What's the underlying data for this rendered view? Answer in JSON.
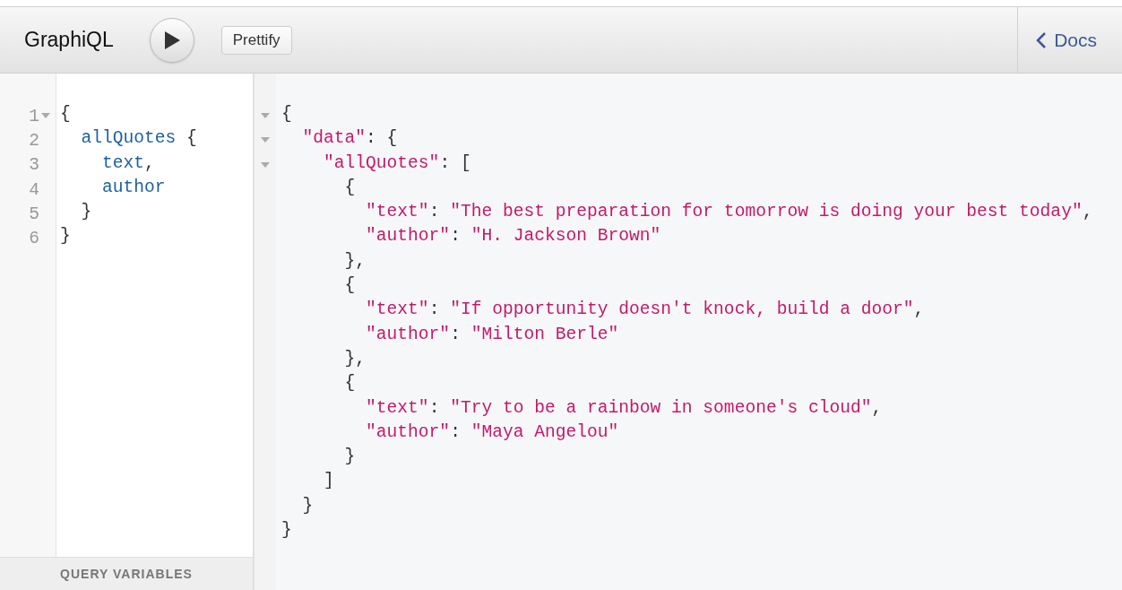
{
  "toolbar": {
    "title": "GraphiQL",
    "prettify_button": "Prettify",
    "docs_button": "Docs"
  },
  "query_editor": {
    "lines": [
      {
        "number": "1",
        "foldable": true,
        "tokens": [
          {
            "kind": "punct",
            "text": "{"
          }
        ]
      },
      {
        "number": "2",
        "foldable": false,
        "tokens": [
          {
            "kind": "field",
            "text": "  allQuotes"
          },
          {
            "kind": "punct",
            "text": " {"
          }
        ]
      },
      {
        "number": "3",
        "foldable": false,
        "tokens": [
          {
            "kind": "field",
            "text": "    text"
          },
          {
            "kind": "punct",
            "text": ","
          }
        ]
      },
      {
        "number": "4",
        "foldable": false,
        "tokens": [
          {
            "kind": "field",
            "text": "    author"
          }
        ]
      },
      {
        "number": "5",
        "foldable": false,
        "tokens": [
          {
            "kind": "punct",
            "text": "  }"
          }
        ]
      },
      {
        "number": "6",
        "foldable": false,
        "tokens": [
          {
            "kind": "punct",
            "text": "}"
          }
        ]
      }
    ],
    "variables_label": "QUERY VARIABLES"
  },
  "result_viewer": {
    "lines": [
      {
        "foldable": true,
        "tokens": [
          {
            "kind": "punct",
            "text": "{"
          }
        ]
      },
      {
        "foldable": true,
        "tokens": [
          {
            "kind": "string",
            "text": "  \"data\""
          },
          {
            "kind": "punct",
            "text": ": {"
          }
        ]
      },
      {
        "foldable": true,
        "tokens": [
          {
            "kind": "string",
            "text": "    \"allQuotes\""
          },
          {
            "kind": "punct",
            "text": ": ["
          }
        ]
      },
      {
        "foldable": false,
        "tokens": [
          {
            "kind": "punct",
            "text": "      {"
          }
        ]
      },
      {
        "foldable": false,
        "tokens": [
          {
            "kind": "string",
            "text": "        \"text\""
          },
          {
            "kind": "punct",
            "text": ": "
          },
          {
            "kind": "string",
            "text": "\"The best preparation for tomorrow is doing your best today\""
          },
          {
            "kind": "punct",
            "text": ","
          }
        ]
      },
      {
        "foldable": false,
        "tokens": [
          {
            "kind": "string",
            "text": "        \"author\""
          },
          {
            "kind": "punct",
            "text": ": "
          },
          {
            "kind": "string",
            "text": "\"H. Jackson Brown\""
          }
        ]
      },
      {
        "foldable": false,
        "tokens": [
          {
            "kind": "punct",
            "text": "      },"
          }
        ]
      },
      {
        "foldable": false,
        "tokens": [
          {
            "kind": "punct",
            "text": "      {"
          }
        ]
      },
      {
        "foldable": false,
        "tokens": [
          {
            "kind": "string",
            "text": "        \"text\""
          },
          {
            "kind": "punct",
            "text": ": "
          },
          {
            "kind": "string",
            "text": "\"If opportunity doesn't knock, build a door\""
          },
          {
            "kind": "punct",
            "text": ","
          }
        ]
      },
      {
        "foldable": false,
        "tokens": [
          {
            "kind": "string",
            "text": "        \"author\""
          },
          {
            "kind": "punct",
            "text": ": "
          },
          {
            "kind": "string",
            "text": "\"Milton Berle\""
          }
        ]
      },
      {
        "foldable": false,
        "tokens": [
          {
            "kind": "punct",
            "text": "      },"
          }
        ]
      },
      {
        "foldable": false,
        "tokens": [
          {
            "kind": "punct",
            "text": "      {"
          }
        ]
      },
      {
        "foldable": false,
        "tokens": [
          {
            "kind": "string",
            "text": "        \"text\""
          },
          {
            "kind": "punct",
            "text": ": "
          },
          {
            "kind": "string",
            "text": "\"Try to be a rainbow in someone's cloud\""
          },
          {
            "kind": "punct",
            "text": ","
          }
        ]
      },
      {
        "foldable": false,
        "tokens": [
          {
            "kind": "string",
            "text": "        \"author\""
          },
          {
            "kind": "punct",
            "text": ": "
          },
          {
            "kind": "string",
            "text": "\"Maya Angelou\""
          }
        ]
      },
      {
        "foldable": false,
        "tokens": [
          {
            "kind": "punct",
            "text": "      }"
          }
        ]
      },
      {
        "foldable": false,
        "tokens": [
          {
            "kind": "punct",
            "text": "    ]"
          }
        ]
      },
      {
        "foldable": false,
        "tokens": [
          {
            "kind": "punct",
            "text": "  }"
          }
        ]
      },
      {
        "foldable": false,
        "tokens": [
          {
            "kind": "punct",
            "text": "}"
          }
        ]
      }
    ]
  }
}
